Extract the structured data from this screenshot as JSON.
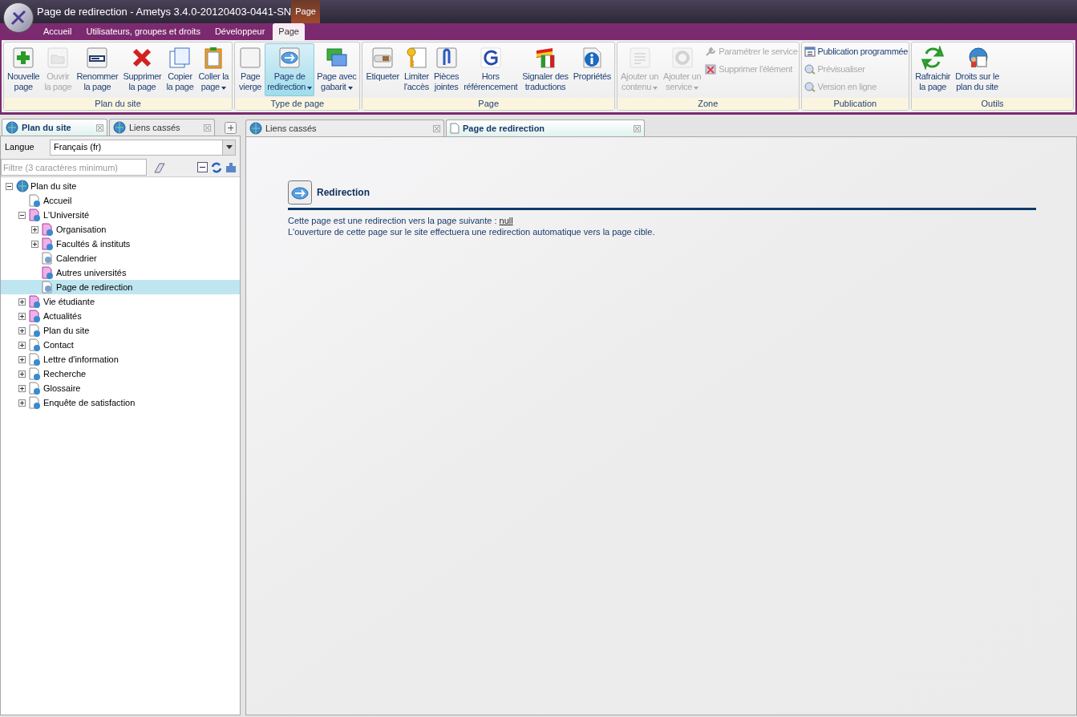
{
  "window": {
    "title": "Page de redirection - Ametys 3.4.0-20120403-0441-SN",
    "context_label": "Page"
  },
  "menu_tabs": [
    {
      "label": "Accueil",
      "selected": false
    },
    {
      "label": "Utilisateurs, groupes et droits",
      "selected": false
    },
    {
      "label": "Développeur",
      "selected": false
    },
    {
      "label": "Page",
      "selected": true
    }
  ],
  "ribbon": [
    {
      "title": "Plan du site",
      "items": [
        {
          "kind": "large",
          "lines": [
            "Nouvelle",
            "page"
          ],
          "disabled": false
        },
        {
          "kind": "large",
          "lines": [
            "Ouvrir",
            "la page"
          ],
          "disabled": true
        },
        {
          "kind": "large",
          "lines": [
            "Renommer",
            "la page"
          ],
          "disabled": false
        },
        {
          "kind": "large",
          "lines": [
            "Supprimer",
            "la page"
          ],
          "disabled": false
        },
        {
          "kind": "large",
          "lines": [
            "Copier",
            "la page"
          ],
          "disabled": false
        },
        {
          "kind": "large",
          "lines": [
            "Coller la",
            "page"
          ],
          "disabled": false,
          "dropdown": true
        }
      ]
    },
    {
      "title": "Type de page",
      "items": [
        {
          "kind": "large",
          "lines": [
            "Page",
            "vierge"
          ],
          "disabled": false,
          "selected": false
        },
        {
          "kind": "large",
          "lines": [
            "Page de",
            "redirection"
          ],
          "disabled": false,
          "dropdown": true,
          "selected": true
        },
        {
          "kind": "large",
          "lines": [
            "Page avec",
            "gabarit"
          ],
          "disabled": false,
          "dropdown": true,
          "selected": false
        }
      ]
    },
    {
      "title": "Page",
      "items": [
        {
          "kind": "large",
          "lines": [
            "Etiqueter"
          ],
          "disabled": false
        },
        {
          "kind": "large",
          "lines": [
            "Limiter",
            "l'accès"
          ],
          "disabled": false
        },
        {
          "kind": "large",
          "lines": [
            "Pièces",
            "jointes"
          ],
          "disabled": false
        },
        {
          "kind": "large",
          "lines": [
            "Hors",
            "référencement"
          ],
          "disabled": false
        },
        {
          "kind": "large",
          "lines": [
            "Signaler des",
            "traductions"
          ],
          "disabled": false
        },
        {
          "kind": "large",
          "lines": [
            "Propriétés"
          ],
          "disabled": false
        }
      ]
    },
    {
      "title": "Zone",
      "items": [
        {
          "kind": "large",
          "lines": [
            "Ajouter un",
            "contenu"
          ],
          "disabled": true,
          "dropdown": true
        },
        {
          "kind": "large",
          "lines": [
            "Ajouter un",
            "service"
          ],
          "disabled": true,
          "dropdown": true
        },
        {
          "kind": "small",
          "lines": [
            "Paramétrer le service"
          ],
          "disabled": true
        },
        {
          "kind": "small",
          "lines": [
            "Supprimer l'élément"
          ],
          "disabled": true
        }
      ]
    },
    {
      "title": "Publication",
      "items": [
        {
          "kind": "small",
          "lines": [
            "Publication programmée"
          ],
          "disabled": false
        },
        {
          "kind": "small",
          "lines": [
            "Prévisualiser"
          ],
          "disabled": true
        },
        {
          "kind": "small",
          "lines": [
            "Version en ligne"
          ],
          "disabled": true
        }
      ]
    },
    {
      "title": "Outils",
      "items": [
        {
          "kind": "large",
          "lines": [
            "Rafraichir",
            "la page"
          ],
          "disabled": false
        },
        {
          "kind": "large",
          "lines": [
            "Droits sur le",
            "plan du site"
          ],
          "disabled": false
        }
      ]
    }
  ],
  "left_panel": {
    "tabs": [
      {
        "label": "Plan du site",
        "selected": true
      },
      {
        "label": "Liens cassés",
        "selected": false
      }
    ],
    "language_label": "Langue",
    "language_value": "Français (fr)",
    "filter": {
      "placeholder": "Filtre (3 caractères minimum)"
    },
    "tree": [
      {
        "label": "Plan du site",
        "kind": "site",
        "expanded": true,
        "selected": false,
        "children": [
          {
            "label": "Accueil",
            "kind": "page",
            "selected": false
          },
          {
            "label": "L'Université",
            "kind": "section",
            "expanded": true,
            "selected": false,
            "children": [
              {
                "label": "Organisation",
                "kind": "section",
                "expanded": false,
                "selected": false
              },
              {
                "label": "Facultés & instituts",
                "kind": "section",
                "expanded": false,
                "selected": false
              },
              {
                "label": "Calendrier",
                "kind": "redirect",
                "selected": false
              },
              {
                "label": "Autres universités",
                "kind": "section",
                "selected": false
              },
              {
                "label": "Page de redirection",
                "kind": "redirect",
                "selected": true
              }
            ]
          },
          {
            "label": "Vie étudiante",
            "kind": "section",
            "expanded": false,
            "selected": false
          },
          {
            "label": "Actualités",
            "kind": "section",
            "expanded": false,
            "selected": false
          },
          {
            "label": "Plan du site",
            "kind": "page",
            "expanded": false,
            "selected": false
          },
          {
            "label": "Contact",
            "kind": "page",
            "expanded": false,
            "selected": false
          },
          {
            "label": "Lettre d'information",
            "kind": "page",
            "expanded": false,
            "selected": false
          },
          {
            "label": "Recherche",
            "kind": "page",
            "expanded": false,
            "selected": false
          },
          {
            "label": "Glossaire",
            "kind": "page",
            "expanded": false,
            "selected": false
          },
          {
            "label": "Enquête de satisfaction",
            "kind": "page",
            "expanded": false,
            "selected": false
          }
        ]
      }
    ]
  },
  "right_panel": {
    "tabs": [
      {
        "label": "Liens cassés",
        "selected": false
      },
      {
        "label": "Page de redirection",
        "selected": true
      }
    ],
    "heading": "Redirection",
    "line_1": "Cette page est une redirection vers la page suivante :",
    "target_link": "null",
    "line_2": "L'ouverture de cette page sur le site effectuera une redirection automatique vers la page cible."
  }
}
